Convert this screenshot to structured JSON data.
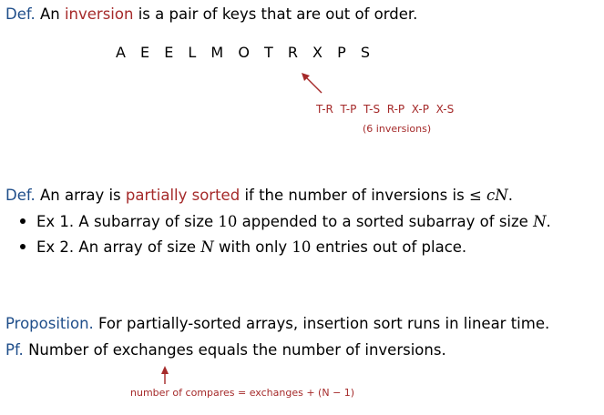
{
  "def1": {
    "label": "Def.",
    "pre": "An",
    "term": "inversion",
    "post": "is a pair of keys that are out of order."
  },
  "keys": "A E E L M O T R X P S",
  "inversions": {
    "pairs": "T-R  T-P  T-S  R-P  X-P  X-S",
    "count": "(6 inversions)"
  },
  "def2": {
    "label": "Def.",
    "pre": "An array is",
    "term": "partially sorted",
    "post": "if the number of inversions is",
    "le": "≤",
    "c": "c",
    "n": "N",
    "end": "."
  },
  "bullets": [
    {
      "pre": "Ex 1. A subarray of size",
      "num": "10",
      "mid": "appended to a sorted subarray of size",
      "n": "N",
      "end": "."
    },
    {
      "pre": "Ex 2. An array of size",
      "n": "N",
      "mid": "with only",
      "num": "10",
      "end": "entries out of place."
    }
  ],
  "prop": {
    "label": "Proposition.",
    "text": "For partially-sorted arrays, insertion sort runs in linear time."
  },
  "pf": {
    "label": "Pf.",
    "text": "Number of exchanges equals the number of inversions."
  },
  "footnote": "number of compares = exchanges + (N − 1)",
  "colors": {
    "label_blue": "#1f4e8a",
    "accent_red": "#a52a2a"
  }
}
